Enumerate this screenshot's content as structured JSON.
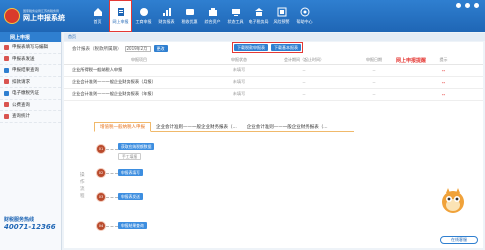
{
  "header": {
    "logo_subtitle": "国家税务总局江苏省税务局",
    "logo_title": "网上申报系统"
  },
  "nav": [
    {
      "label": "首页",
      "icon": "home-icon"
    },
    {
      "label": "网上申报",
      "icon": "declare-icon",
      "active": true
    },
    {
      "label": "工商申报",
      "icon": "business-icon"
    },
    {
      "label": "财务报表",
      "icon": "report-icon"
    },
    {
      "label": "税收优惠",
      "icon": "discount-icon"
    },
    {
      "label": "综合资产",
      "icon": "asset-icon"
    },
    {
      "label": "状态工具",
      "icon": "tool-icon"
    },
    {
      "label": "电子税务局",
      "icon": "bureau-icon"
    },
    {
      "label": "风险预警",
      "icon": "risk-icon"
    },
    {
      "label": "帮助中心",
      "icon": "help-icon"
    }
  ],
  "sidebar": {
    "title": "网上申报",
    "items": [
      "申报表填写与编辑",
      "申报表发送",
      "申报结果查询",
      "扣款请求",
      "电子缴税凭证",
      "公费查询",
      "查询统计"
    ],
    "hotline_label": "财税服务热线",
    "hotline_number": "40071-12366"
  },
  "breadcrumb": "首页",
  "filter": {
    "label": "会计报表（税款所属期）",
    "period": "2019年2月",
    "change_button": "更改",
    "download_all": "下载税款申报表",
    "download_one": "下载基本报表"
  },
  "hint": "网上申报提醒",
  "table": {
    "columns": [
      "申报项目",
      "申报状态",
      "会计期间（起止时间）",
      "申报日期",
      "提示"
    ],
    "rows": [
      {
        "name": "企业所得税一般纳税人申报",
        "status": "未填写",
        "period": "--",
        "date": "--",
        "tip": "--"
      },
      {
        "name": "企业会计准则——一般企业财务报表（月报）",
        "status": "未填写",
        "period": "--",
        "date": "--",
        "tip": "--"
      },
      {
        "name": "企业会计准则——一般企业财务报表（年报）",
        "status": "未填写",
        "period": "--",
        "date": "--",
        "tip": "--"
      }
    ]
  },
  "tabs": [
    "增值税一般纳税人申报",
    "企业会计准则——一般企业财务报表（...",
    "企业会计准则——一般企业财务报表（..."
  ],
  "flow": {
    "label": "操作流程",
    "steps": [
      {
        "num": "01",
        "buttons": [
          "获取应纳税额数据",
          "手工填报"
        ]
      },
      {
        "num": "02",
        "buttons": [
          "申报表填写"
        ]
      },
      {
        "num": "03",
        "buttons": [
          "申报表发送"
        ]
      },
      {
        "num": "04",
        "buttons": [
          "申报结果查询"
        ]
      }
    ]
  },
  "online_service": "在线客服",
  "colors": {
    "primary": "#1f66b5",
    "accent": "#e53935",
    "tab_active": "#e8741c"
  }
}
